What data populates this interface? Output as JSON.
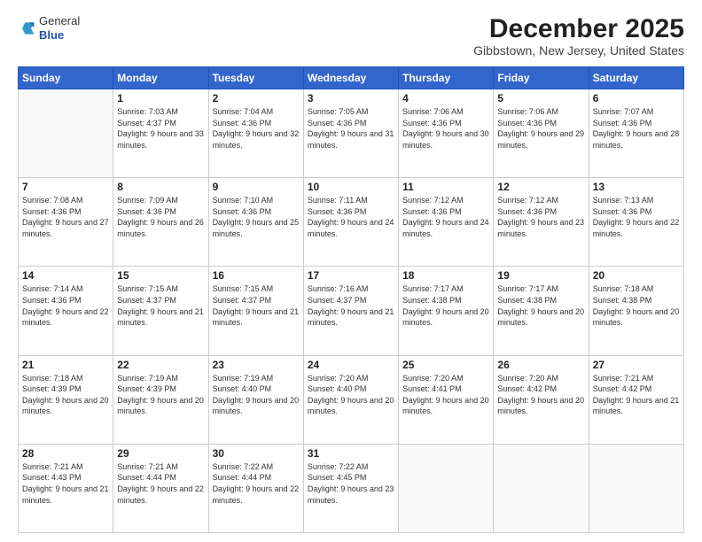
{
  "header": {
    "logo": {
      "general": "General",
      "blue": "Blue"
    },
    "title": "December 2025",
    "location": "Gibbstown, New Jersey, United States"
  },
  "days_of_week": [
    "Sunday",
    "Monday",
    "Tuesday",
    "Wednesday",
    "Thursday",
    "Friday",
    "Saturday"
  ],
  "weeks": [
    [
      {
        "day": "",
        "sunrise": "",
        "sunset": "",
        "daylight": ""
      },
      {
        "day": "1",
        "sunrise": "Sunrise: 7:03 AM",
        "sunset": "Sunset: 4:37 PM",
        "daylight": "Daylight: 9 hours and 33 minutes."
      },
      {
        "day": "2",
        "sunrise": "Sunrise: 7:04 AM",
        "sunset": "Sunset: 4:36 PM",
        "daylight": "Daylight: 9 hours and 32 minutes."
      },
      {
        "day": "3",
        "sunrise": "Sunrise: 7:05 AM",
        "sunset": "Sunset: 4:36 PM",
        "daylight": "Daylight: 9 hours and 31 minutes."
      },
      {
        "day": "4",
        "sunrise": "Sunrise: 7:06 AM",
        "sunset": "Sunset: 4:36 PM",
        "daylight": "Daylight: 9 hours and 30 minutes."
      },
      {
        "day": "5",
        "sunrise": "Sunrise: 7:06 AM",
        "sunset": "Sunset: 4:36 PM",
        "daylight": "Daylight: 9 hours and 29 minutes."
      },
      {
        "day": "6",
        "sunrise": "Sunrise: 7:07 AM",
        "sunset": "Sunset: 4:36 PM",
        "daylight": "Daylight: 9 hours and 28 minutes."
      }
    ],
    [
      {
        "day": "7",
        "sunrise": "Sunrise: 7:08 AM",
        "sunset": "Sunset: 4:36 PM",
        "daylight": "Daylight: 9 hours and 27 minutes."
      },
      {
        "day": "8",
        "sunrise": "Sunrise: 7:09 AM",
        "sunset": "Sunset: 4:36 PM",
        "daylight": "Daylight: 9 hours and 26 minutes."
      },
      {
        "day": "9",
        "sunrise": "Sunrise: 7:10 AM",
        "sunset": "Sunset: 4:36 PM",
        "daylight": "Daylight: 9 hours and 25 minutes."
      },
      {
        "day": "10",
        "sunrise": "Sunrise: 7:11 AM",
        "sunset": "Sunset: 4:36 PM",
        "daylight": "Daylight: 9 hours and 24 minutes."
      },
      {
        "day": "11",
        "sunrise": "Sunrise: 7:12 AM",
        "sunset": "Sunset: 4:36 PM",
        "daylight": "Daylight: 9 hours and 24 minutes."
      },
      {
        "day": "12",
        "sunrise": "Sunrise: 7:12 AM",
        "sunset": "Sunset: 4:36 PM",
        "daylight": "Daylight: 9 hours and 23 minutes."
      },
      {
        "day": "13",
        "sunrise": "Sunrise: 7:13 AM",
        "sunset": "Sunset: 4:36 PM",
        "daylight": "Daylight: 9 hours and 22 minutes."
      }
    ],
    [
      {
        "day": "14",
        "sunrise": "Sunrise: 7:14 AM",
        "sunset": "Sunset: 4:36 PM",
        "daylight": "Daylight: 9 hours and 22 minutes."
      },
      {
        "day": "15",
        "sunrise": "Sunrise: 7:15 AM",
        "sunset": "Sunset: 4:37 PM",
        "daylight": "Daylight: 9 hours and 21 minutes."
      },
      {
        "day": "16",
        "sunrise": "Sunrise: 7:15 AM",
        "sunset": "Sunset: 4:37 PM",
        "daylight": "Daylight: 9 hours and 21 minutes."
      },
      {
        "day": "17",
        "sunrise": "Sunrise: 7:16 AM",
        "sunset": "Sunset: 4:37 PM",
        "daylight": "Daylight: 9 hours and 21 minutes."
      },
      {
        "day": "18",
        "sunrise": "Sunrise: 7:17 AM",
        "sunset": "Sunset: 4:38 PM",
        "daylight": "Daylight: 9 hours and 20 minutes."
      },
      {
        "day": "19",
        "sunrise": "Sunrise: 7:17 AM",
        "sunset": "Sunset: 4:38 PM",
        "daylight": "Daylight: 9 hours and 20 minutes."
      },
      {
        "day": "20",
        "sunrise": "Sunrise: 7:18 AM",
        "sunset": "Sunset: 4:38 PM",
        "daylight": "Daylight: 9 hours and 20 minutes."
      }
    ],
    [
      {
        "day": "21",
        "sunrise": "Sunrise: 7:18 AM",
        "sunset": "Sunset: 4:39 PM",
        "daylight": "Daylight: 9 hours and 20 minutes."
      },
      {
        "day": "22",
        "sunrise": "Sunrise: 7:19 AM",
        "sunset": "Sunset: 4:39 PM",
        "daylight": "Daylight: 9 hours and 20 minutes."
      },
      {
        "day": "23",
        "sunrise": "Sunrise: 7:19 AM",
        "sunset": "Sunset: 4:40 PM",
        "daylight": "Daylight: 9 hours and 20 minutes."
      },
      {
        "day": "24",
        "sunrise": "Sunrise: 7:20 AM",
        "sunset": "Sunset: 4:40 PM",
        "daylight": "Daylight: 9 hours and 20 minutes."
      },
      {
        "day": "25",
        "sunrise": "Sunrise: 7:20 AM",
        "sunset": "Sunset: 4:41 PM",
        "daylight": "Daylight: 9 hours and 20 minutes."
      },
      {
        "day": "26",
        "sunrise": "Sunrise: 7:20 AM",
        "sunset": "Sunset: 4:42 PM",
        "daylight": "Daylight: 9 hours and 20 minutes."
      },
      {
        "day": "27",
        "sunrise": "Sunrise: 7:21 AM",
        "sunset": "Sunset: 4:42 PM",
        "daylight": "Daylight: 9 hours and 21 minutes."
      }
    ],
    [
      {
        "day": "28",
        "sunrise": "Sunrise: 7:21 AM",
        "sunset": "Sunset: 4:43 PM",
        "daylight": "Daylight: 9 hours and 21 minutes."
      },
      {
        "day": "29",
        "sunrise": "Sunrise: 7:21 AM",
        "sunset": "Sunset: 4:44 PM",
        "daylight": "Daylight: 9 hours and 22 minutes."
      },
      {
        "day": "30",
        "sunrise": "Sunrise: 7:22 AM",
        "sunset": "Sunset: 4:44 PM",
        "daylight": "Daylight: 9 hours and 22 minutes."
      },
      {
        "day": "31",
        "sunrise": "Sunrise: 7:22 AM",
        "sunset": "Sunset: 4:45 PM",
        "daylight": "Daylight: 9 hours and 23 minutes."
      },
      {
        "day": "",
        "sunrise": "",
        "sunset": "",
        "daylight": ""
      },
      {
        "day": "",
        "sunrise": "",
        "sunset": "",
        "daylight": ""
      },
      {
        "day": "",
        "sunrise": "",
        "sunset": "",
        "daylight": ""
      }
    ]
  ]
}
